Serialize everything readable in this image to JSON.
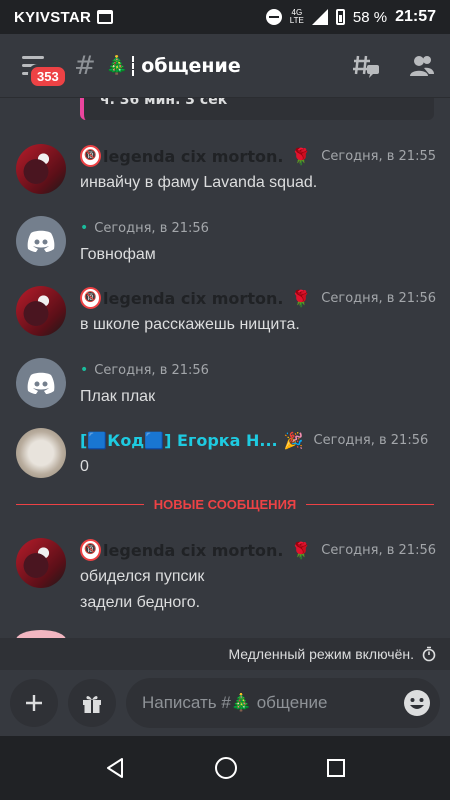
{
  "status_bar": {
    "carrier": "KYIVSTAR",
    "network": "4G LTE",
    "battery": "58 %",
    "time": "21:57"
  },
  "header": {
    "unread_badge": "353",
    "hash": "#",
    "channel_emoji": "🎄",
    "channel_name": "общение"
  },
  "pinned_preview": {
    "text": "ч. 36 мин. 3 сек"
  },
  "messages": [
    {
      "author": "legenda cix morton...",
      "author_badge": "🔞",
      "role_icon": "🌹",
      "timestamp": "Сегодня, в 21:55",
      "lines": [
        "инвайчу в фаму Lavanda squad."
      ]
    },
    {
      "author": "",
      "timestamp": "Сегодня, в 21:56",
      "lines": [
        "Говнофам"
      ]
    },
    {
      "author": "legenda cix morton...",
      "author_badge": "🔞",
      "role_icon": "🌹",
      "timestamp": "Сегодня, в 21:56",
      "lines": [
        "в школе расскажешь нищита."
      ]
    },
    {
      "author": "",
      "timestamp": "Сегодня, в 21:56",
      "lines": [
        "Плак плак"
      ]
    },
    {
      "author": "[🟦Код🟦] Егорка Н...",
      "role_icon": "🎉",
      "timestamp": "Сегодня, в 21:56",
      "lines": [
        "0"
      ]
    },
    {
      "author": "legenda cix morton...",
      "author_badge": "🔞",
      "role_icon": "🌹",
      "timestamp": "Сегодня, в 21:56",
      "lines": [
        "обиделся пупсик",
        "задели бедного."
      ]
    }
  ],
  "new_messages_divider": "НОВЫЕ СООБЩЕНИЯ",
  "slow_mode": {
    "text": "Медленный режим включён.",
    "icon": "timer-icon"
  },
  "composer": {
    "placeholder": "Написать #🎄 общение",
    "add_icon": "plus-icon",
    "gift_icon": "gift-icon",
    "emoji_icon": "emoji-icon"
  },
  "colors": {
    "accent_red": "#ed4245",
    "cyan_name": "#1ecbe1",
    "background": "#36393f",
    "pinned_bar": "#eb459e"
  }
}
